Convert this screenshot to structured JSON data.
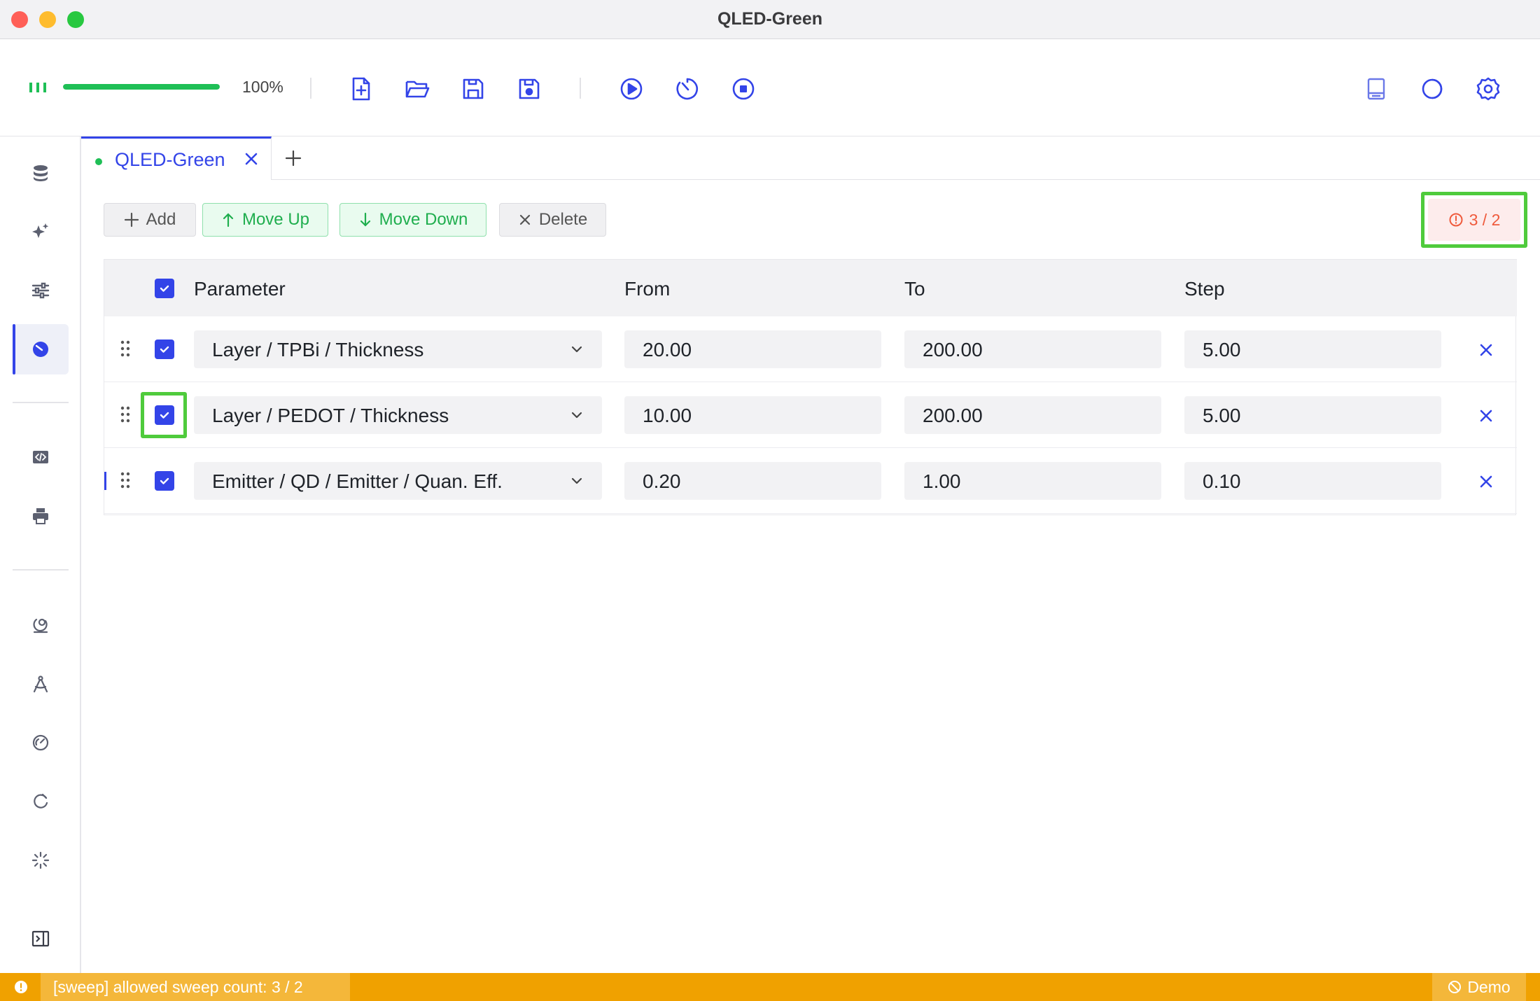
{
  "window": {
    "title": "QLED-Green"
  },
  "toolbar": {
    "progress_text": "100%",
    "progress_fraction": 1.0,
    "icons": [
      "levels-icon",
      "new-file-icon",
      "open-folder-icon",
      "save-icon",
      "save-as-icon",
      "play-icon",
      "timer-icon",
      "stop-icon",
      "panel-icon",
      "theme-icon",
      "settings-icon"
    ]
  },
  "sidebar": {
    "items": [
      "database-icon",
      "sparkle-icon",
      "sliders-icon",
      "sweep-icon",
      "code-icon",
      "print-icon",
      "palette-icon",
      "compass-icon",
      "gauge-icon",
      "refresh-icon",
      "loading-icon",
      "collapse-panel-icon"
    ],
    "active": "sweep-icon"
  },
  "tabs": [
    {
      "label": "QLED-Green",
      "status_color": "#1fbf56"
    }
  ],
  "actions": {
    "add": "Add",
    "move_up": "Move Up",
    "move_down": "Move Down",
    "delete": "Delete"
  },
  "sweep_count": {
    "text": "3 / 2",
    "color": "#ef5a3c"
  },
  "table": {
    "headers": {
      "parameter": "Parameter",
      "from": "From",
      "to": "To",
      "step": "Step"
    },
    "rows": [
      {
        "checked": true,
        "parameter": "Layer / TPBi / Thickness",
        "from": "20.00",
        "to": "200.00",
        "step": "5.00"
      },
      {
        "checked": true,
        "parameter": "Layer / PEDOT / Thickness",
        "from": "10.00",
        "to": "200.00",
        "step": "5.00"
      },
      {
        "checked": true,
        "parameter": "Emitter / QD / Emitter / Quan. Eff.",
        "from": "0.20",
        "to": "1.00",
        "step": "0.10"
      }
    ]
  },
  "status": {
    "message": "[sweep] allowed sweep count: 3 / 2",
    "mode": "Demo"
  },
  "colors": {
    "accent": "#3344e8",
    "success": "#1fbf56",
    "warning": "#f0a100",
    "error": "#ef5a3c"
  }
}
